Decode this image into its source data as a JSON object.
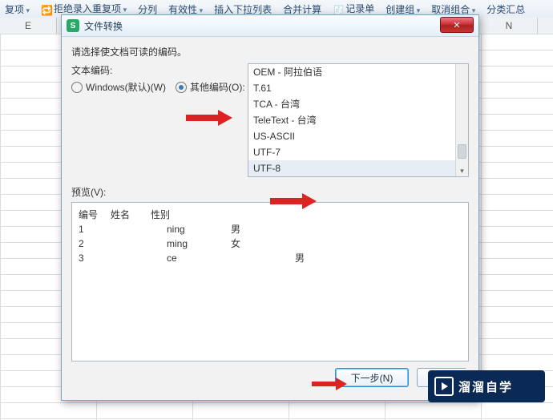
{
  "ribbon": {
    "items": [
      "复项",
      "拒绝录入重复项",
      "分列",
      "有效性",
      "插入下拉列表",
      "合并计算",
      "记录单",
      "创建组",
      "取消组合",
      "分类汇总"
    ]
  },
  "columns": {
    "E": "E",
    "N": "N"
  },
  "dialog": {
    "title": "文件转换",
    "close": "✕",
    "instruction": "请选择使文档可读的编码。",
    "encoding_label": "文本编码:",
    "radio_windows": "Windows(默认)(W)",
    "radio_other": "其他编码(O):",
    "encodings": [
      "OEM - 阿拉伯语",
      "T.61",
      "TCA - 台湾",
      "TeleText - 台湾",
      "US-ASCII",
      "UTF-7",
      "UTF-8"
    ],
    "preview_label": "预览(V):",
    "preview": {
      "headers": [
        "编号",
        "姓名",
        "性别"
      ],
      "rows": [
        {
          "n": "1",
          "name": "ning",
          "g": "男",
          "far": false
        },
        {
          "n": "2",
          "name": "ming",
          "g": "女",
          "far": false
        },
        {
          "n": "3",
          "name": "ce",
          "g": "男",
          "far": true
        }
      ]
    },
    "next": "下一步(N)",
    "cancel": "取"
  },
  "watermark": "溜溜自学"
}
